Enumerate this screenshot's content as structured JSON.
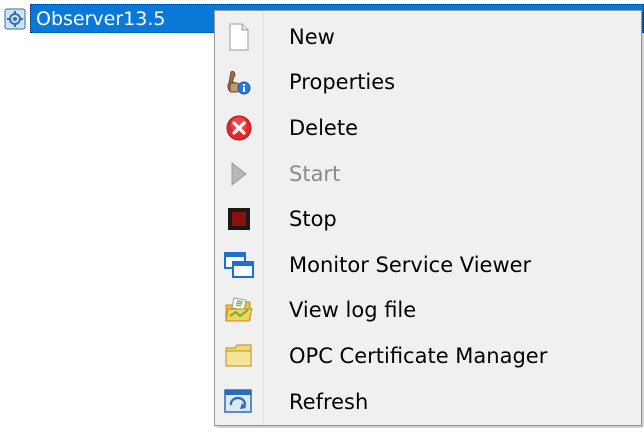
{
  "tree": {
    "node_label": "Observer13.5",
    "node_icon": "service-gear-icon",
    "selection_color": "#0a78d7"
  },
  "context_menu": {
    "items": [
      {
        "label": "New",
        "icon": "new-document-icon",
        "enabled": true
      },
      {
        "label": "Properties",
        "icon": "properties-icon",
        "enabled": true
      },
      {
        "label": "Delete",
        "icon": "delete-icon",
        "enabled": true
      },
      {
        "label": "Start",
        "icon": "play-icon",
        "enabled": false
      },
      {
        "label": "Stop",
        "icon": "stop-icon",
        "enabled": true
      },
      {
        "label": "Monitor Service Viewer",
        "icon": "windows-icon",
        "enabled": true
      },
      {
        "label": "View log file",
        "icon": "open-folder-icon",
        "enabled": true
      },
      {
        "label": "OPC Certificate Manager",
        "icon": "folder-icon",
        "enabled": true
      },
      {
        "label": "Refresh",
        "icon": "refresh-icon",
        "enabled": true
      }
    ]
  }
}
